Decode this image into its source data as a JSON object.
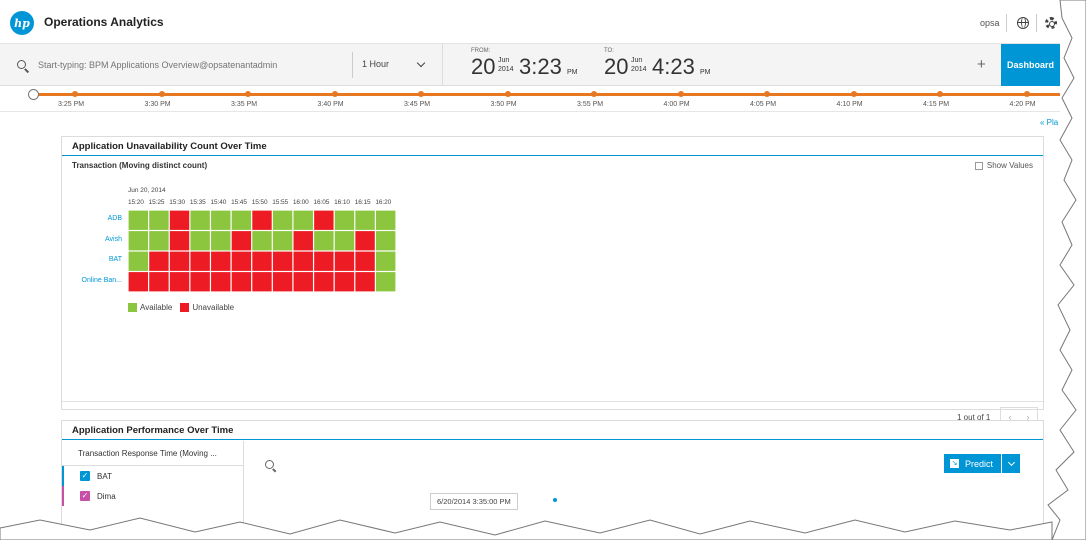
{
  "app": {
    "title": "Operations Analytics",
    "user": "opsa"
  },
  "search": {
    "placeholder": "Start-typing: BPM Applications Overview@opsatenantadmin"
  },
  "range": {
    "selected": "1 Hour"
  },
  "time_from": {
    "caption": "FROM:",
    "day": "20",
    "month": "Jun",
    "year": "2014",
    "time": "3:23",
    "ampm": "PM"
  },
  "time_to": {
    "caption": "TO:",
    "day": "20",
    "month": "Jun",
    "year": "2014",
    "time": "4:23",
    "ampm": "PM"
  },
  "toolbar": {
    "add_label": "+",
    "dashboard_label": "Dashboard"
  },
  "timeline": {
    "ticks": [
      "3:25 PM",
      "3:30 PM",
      "3:35 PM",
      "3:40 PM",
      "3:45 PM",
      "3:50 PM",
      "3:55 PM",
      "4:00 PM",
      "4:05 PM",
      "4:10 PM",
      "4:15 PM",
      "4:20 PM"
    ]
  },
  "collapse_label": "« Pla",
  "unavailability_panel": {
    "title": "Application Unavailability Count Over Time",
    "subtitle": "Transaction (Moving distinct count)",
    "show_values_label": "Show Values",
    "date_label": "Jun 20, 2014",
    "legend": {
      "available": "Available",
      "unavailable": "Unavailable"
    },
    "pager": "1 out of 1"
  },
  "chart_data": {
    "type": "heatmap",
    "title": "Application Unavailability Count Over Time",
    "subtitle": "Transaction (Moving distinct count)",
    "x": [
      "15:20",
      "15:25",
      "15:30",
      "15:35",
      "15:40",
      "15:45",
      "15:50",
      "15:55",
      "16:00",
      "16:05",
      "16:10",
      "16:15",
      "16:20"
    ],
    "y": [
      "ADB",
      "Avish",
      "BAT",
      "Online Ban..."
    ],
    "values": [
      [
        0,
        0,
        1,
        0,
        0,
        0,
        1,
        0,
        0,
        1,
        0,
        0,
        0
      ],
      [
        0,
        0,
        1,
        0,
        0,
        1,
        0,
        0,
        1,
        0,
        0,
        1,
        0
      ],
      [
        0,
        1,
        1,
        1,
        1,
        1,
        1,
        1,
        1,
        1,
        1,
        1,
        0
      ],
      [
        1,
        1,
        1,
        1,
        1,
        1,
        1,
        1,
        1,
        1,
        1,
        1,
        0
      ]
    ],
    "legend": [
      "Available",
      "Unavailable"
    ],
    "colors": {
      "available": "#8cc63f",
      "unavailable": "#ed1c24"
    }
  },
  "performance_panel": {
    "title": "Application Performance Over Time",
    "list_header": "Transaction Response Time (Moving ...",
    "items": [
      {
        "label": "BAT",
        "color": "#0096d6"
      },
      {
        "label": "Dima",
        "color": "#c84fa7"
      }
    ],
    "predict_label": "Predict",
    "tooltip": "6/20/2014 3:35:00 PM"
  },
  "colors": {
    "accent": "#0096d6",
    "timeline": "#e87722"
  }
}
